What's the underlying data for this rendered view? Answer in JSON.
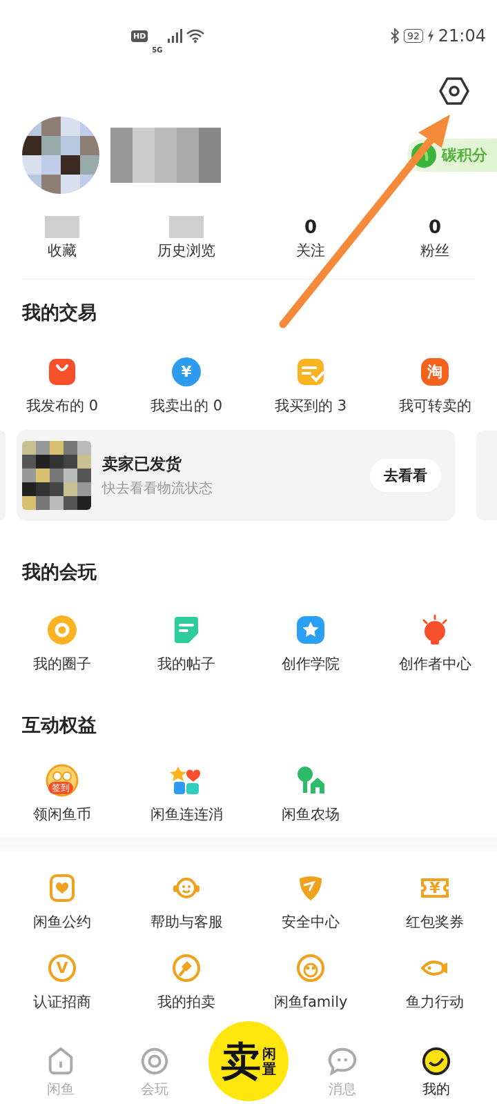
{
  "status_bar": {
    "hd_badge": "HD",
    "network": "5G",
    "battery": "92",
    "time": "21:04"
  },
  "profile": {
    "carbon_badge": "碳积分"
  },
  "stats": [
    {
      "label": "收藏"
    },
    {
      "label": "历史浏览"
    },
    {
      "value": "0",
      "label": "关注"
    },
    {
      "value": "0",
      "label": "粉丝"
    }
  ],
  "trade": {
    "title": "我的交易",
    "items": [
      {
        "label": "我发布的 0"
      },
      {
        "label": "我卖出的 0",
        "icon_text": "¥"
      },
      {
        "label": "我买到的 3"
      },
      {
        "label": "我可转卖的",
        "icon_text": "淘"
      }
    ]
  },
  "shipment_card": {
    "title": "卖家已发货",
    "subtitle": "快去看看物流状态",
    "button": "去看看"
  },
  "play": {
    "title": "我的会玩",
    "items": [
      {
        "label": "我的圈子"
      },
      {
        "label": "我的帖子"
      },
      {
        "label": "创作学院"
      },
      {
        "label": "创作者中心"
      }
    ]
  },
  "benefits": {
    "title": "互动权益",
    "items": [
      {
        "label": "领闲鱼币",
        "badge": "签到"
      },
      {
        "label": "闲鱼连连消"
      },
      {
        "label": "闲鱼农场"
      }
    ]
  },
  "services": {
    "items": [
      {
        "label": "闲鱼公约"
      },
      {
        "label": "帮助与客服"
      },
      {
        "label": "安全中心"
      },
      {
        "label": "红包奖券",
        "icon_text": "¥"
      },
      {
        "label": "认证招商",
        "icon_text": "V"
      },
      {
        "label": "我的拍卖"
      },
      {
        "label": "闲鱼family"
      },
      {
        "label": "鱼力行动"
      }
    ]
  },
  "tab_bar": {
    "items": [
      {
        "label": "闲鱼",
        "selected": false
      },
      {
        "label": "会玩",
        "selected": false
      },
      {
        "label": "消息",
        "selected": false
      },
      {
        "label": "我的",
        "selected": true
      }
    ],
    "sell_button": {
      "main": "卖",
      "side": "闲置"
    }
  }
}
